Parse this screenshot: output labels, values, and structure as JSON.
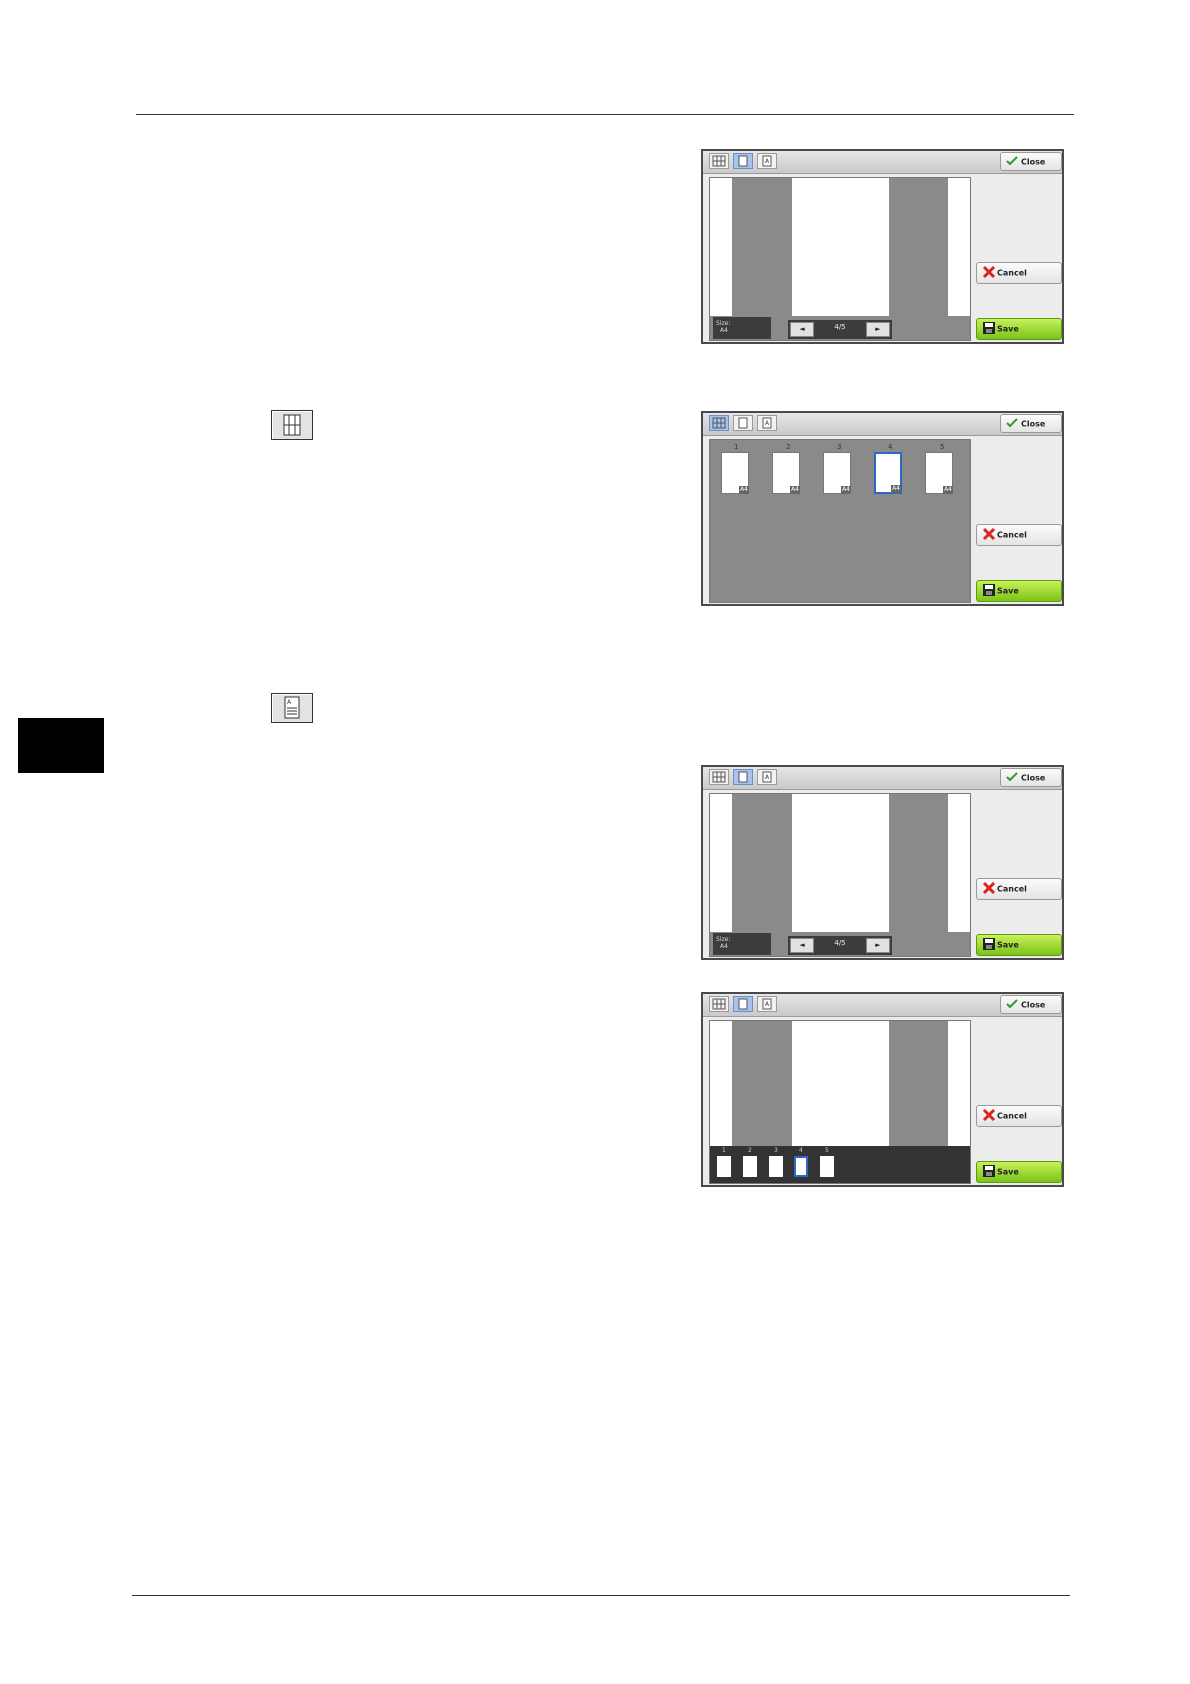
{
  "labels": {
    "close": "Close",
    "cancel": "Cancel",
    "save": "Save",
    "size_label": "Size:",
    "size_value": "A4",
    "page_counter": "4/5",
    "prev_arrow": "◄",
    "next_arrow": "►",
    "thumb_size": "A4"
  },
  "thumbnails": [
    "1",
    "2",
    "3",
    "4",
    "5"
  ],
  "selected_page": 4,
  "colors": {
    "save_green": "#8fd624",
    "selection_blue": "#2b68c9",
    "active_tab": "#a8c4ee"
  }
}
